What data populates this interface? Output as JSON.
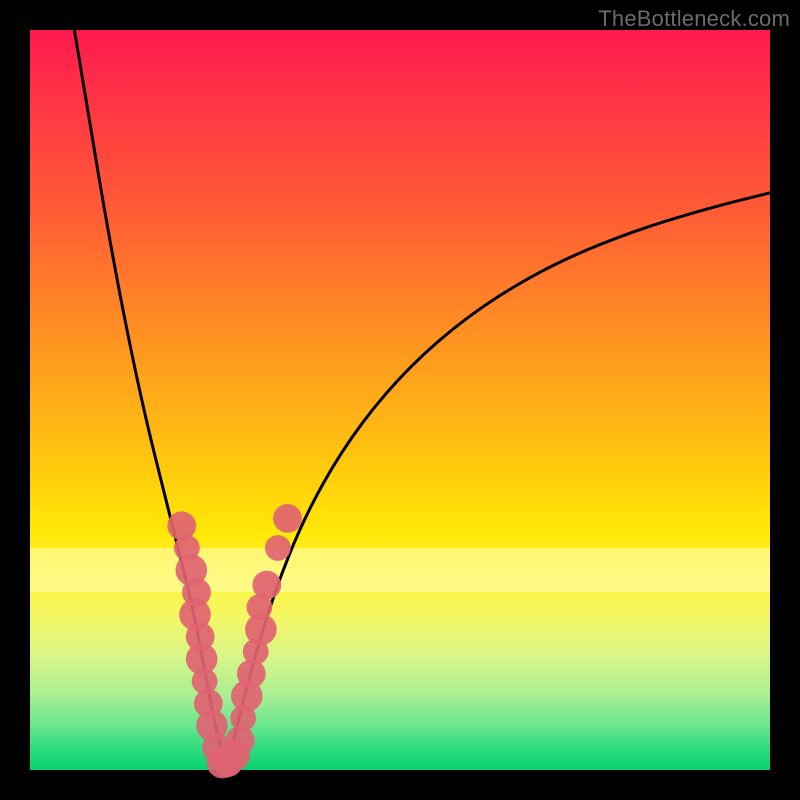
{
  "watermark": "TheBottleneck.com",
  "colors": {
    "marker": "#e06372",
    "curve": "#000000",
    "frame": "#000000"
  },
  "chart_data": {
    "type": "line",
    "title": "",
    "xlabel": "",
    "ylabel": "",
    "xlim": [
      0,
      100
    ],
    "ylim": [
      0,
      100
    ],
    "grid": false,
    "legend": false,
    "series": [
      {
        "name": "bottleneck-curve",
        "x": [
          6,
          8,
          10,
          12,
          14,
          16,
          18,
          20,
          22,
          23.5,
          25,
          26.5,
          28,
          30,
          33,
          37,
          42,
          48,
          55,
          63,
          72,
          82,
          92,
          100
        ],
        "y": [
          100,
          88,
          76,
          65,
          55,
          46,
          38,
          30,
          22,
          14,
          6,
          0,
          6,
          14,
          24,
          34,
          43,
          51,
          58,
          64,
          69,
          73,
          76,
          78
        ]
      }
    ],
    "markers": [
      {
        "x": 20.5,
        "y": 33,
        "r": 1.4
      },
      {
        "x": 21.2,
        "y": 30,
        "r": 1.2
      },
      {
        "x": 21.8,
        "y": 27,
        "r": 1.6
      },
      {
        "x": 22.5,
        "y": 24,
        "r": 1.4
      },
      {
        "x": 22.3,
        "y": 21,
        "r": 1.6
      },
      {
        "x": 23.0,
        "y": 18,
        "r": 1.4
      },
      {
        "x": 23.2,
        "y": 15,
        "r": 1.6
      },
      {
        "x": 23.6,
        "y": 12,
        "r": 1.2
      },
      {
        "x": 24.1,
        "y": 9,
        "r": 1.4
      },
      {
        "x": 24.6,
        "y": 6,
        "r": 1.6
      },
      {
        "x": 25.2,
        "y": 3,
        "r": 1.4
      },
      {
        "x": 26.0,
        "y": 1,
        "r": 1.6
      },
      {
        "x": 26.8,
        "y": 1,
        "r": 1.4
      },
      {
        "x": 27.6,
        "y": 2,
        "r": 1.6
      },
      {
        "x": 28.4,
        "y": 4,
        "r": 1.4
      },
      {
        "x": 28.8,
        "y": 7,
        "r": 1.2
      },
      {
        "x": 29.3,
        "y": 10,
        "r": 1.6
      },
      {
        "x": 29.9,
        "y": 13,
        "r": 1.4
      },
      {
        "x": 30.5,
        "y": 16,
        "r": 1.2
      },
      {
        "x": 31.2,
        "y": 19,
        "r": 1.6
      },
      {
        "x": 31.0,
        "y": 22,
        "r": 1.2
      },
      {
        "x": 32.0,
        "y": 25,
        "r": 1.4
      },
      {
        "x": 33.5,
        "y": 30,
        "r": 1.2
      },
      {
        "x": 34.8,
        "y": 34,
        "r": 1.4
      }
    ],
    "highlight_band": {
      "y_from": 24,
      "y_to": 30
    }
  }
}
